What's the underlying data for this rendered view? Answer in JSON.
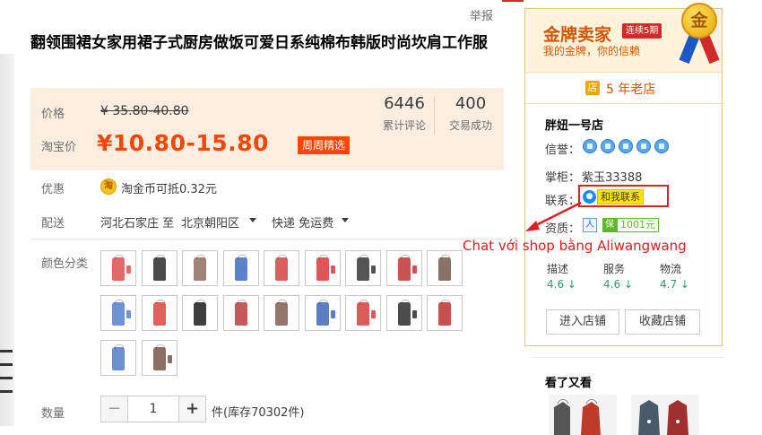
{
  "header": {
    "report_label": "举报"
  },
  "product": {
    "title": "翻领围裙女家用裙子式厨房做饭可爱日系纯棉布韩版时尚坎肩工作服",
    "price_label": "价格",
    "original_price": "¥ 35.80-40.80",
    "taobao_price_label": "淘宝价",
    "current_price": "¥10.80-15.80",
    "promo_badge": "周周精选",
    "stats": [
      {
        "value": "6446",
        "label": "累计评论"
      },
      {
        "value": "400",
        "label": "交易成功"
      }
    ],
    "discount_label": "优惠",
    "coin_icon_text": "淘",
    "coin_text": "淘金币可抵0.32元",
    "shipping_label": "配送",
    "ship_from": "河北石家庄 至",
    "ship_to": "北京朝阳区",
    "ship_method": "快递 免运费",
    "color_label": "颜色分类",
    "quantity_label": "数量",
    "quantity_minus": "−",
    "quantity_value": "1",
    "quantity_plus": "+",
    "stock_text": "件(库存70302件)"
  },
  "swatches": [
    {
      "color": "#e06a6a",
      "sleeve": "#e06a6a"
    },
    {
      "color": "#4a4a4a",
      "sleeve": ""
    },
    {
      "color": "#a08478",
      "sleeve": ""
    },
    {
      "color": "#5b83c9",
      "sleeve": ""
    },
    {
      "color": "#d9605e",
      "sleeve": ""
    },
    {
      "color": "#e25555",
      "sleeve": "#e25555"
    },
    {
      "color": "#555555",
      "sleeve": "#555555"
    },
    {
      "color": "#c95454",
      "sleeve": "#c95454"
    },
    {
      "color": "#8a7268",
      "sleeve": ""
    },
    {
      "color": "#6e92d2",
      "sleeve": "#6e92d2"
    },
    {
      "color": "#e1605a",
      "sleeve": ""
    },
    {
      "color": "#3f3f3f",
      "sleeve": ""
    },
    {
      "color": "#c45a5a",
      "sleeve": ""
    },
    {
      "color": "#93766c",
      "sleeve": ""
    },
    {
      "color": "#5d7fc2",
      "sleeve": "#5d7fc2"
    },
    {
      "color": "#dd5a5a",
      "sleeve": "#dd5a5a"
    },
    {
      "color": "#4c4c4c",
      "sleeve": "#4c4c4c"
    },
    {
      "color": "#c65050",
      "sleeve": ""
    },
    {
      "color": "#6b8fd0",
      "sleeve": ""
    },
    {
      "color": "#8c6f64",
      "sleeve": "#8c6f64"
    }
  ],
  "shop": {
    "gold_title": "金牌卖家",
    "years_badge": "连续5期",
    "slogan": "我的金牌，你的信赖",
    "medal_text": "金",
    "old_shop_icon": "店",
    "old_shop_text": "5 年老店",
    "name": "胖妞一号店",
    "credit_label": "信誉：",
    "seller_label": "掌柜：",
    "seller_id": "紫玉33388",
    "contact_label": "联系：",
    "contact_button": "和我联系",
    "quality_label": "资质：",
    "quality_icon1": "人",
    "quality_icon2": "保",
    "quality_number": "1001元",
    "scores": [
      {
        "label": "描述",
        "value": "4.6 ↓"
      },
      {
        "label": "服务",
        "value": "4.6 ↓"
      },
      {
        "label": "物流",
        "value": "4.7 ↓"
      }
    ],
    "enter_shop_button": "进入店铺",
    "favorite_shop_button": "收藏店铺"
  },
  "seen": {
    "title": "看了又看"
  },
  "annotation": {
    "text": "Chat với shop bằng Aliwangwang",
    "color": "#e11d1d"
  }
}
